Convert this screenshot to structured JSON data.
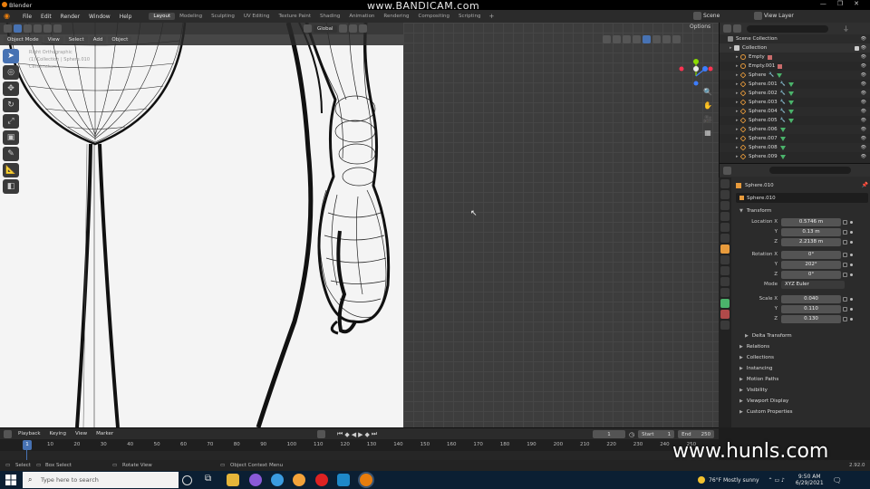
{
  "window": {
    "title": "Blender",
    "recorder_watermark": "www.BANDICAM.com"
  },
  "menubar": {
    "menus": [
      "File",
      "Edit",
      "Render",
      "Window",
      "Help"
    ],
    "workspaces": [
      "Layout",
      "Modeling",
      "Sculpting",
      "UV Editing",
      "Texture Paint",
      "Shading",
      "Animation",
      "Rendering",
      "Compositing",
      "Scripting"
    ],
    "active_workspace": "Layout",
    "scene_label": "Scene",
    "view_layer_label": "View Layer"
  },
  "viewport": {
    "mode": "Object Mode",
    "menus": [
      "View",
      "Select",
      "Add",
      "Object"
    ],
    "transform_orientation": "Global",
    "options_label": "Options",
    "info_lines": [
      "Right Orthographic",
      "(1) Collection | Sphere.010",
      "Centimeters"
    ]
  },
  "outliner": {
    "items": [
      {
        "name": "Scene Collection",
        "type": "scene",
        "indent": 0,
        "mods": 0
      },
      {
        "name": "Collection",
        "type": "collection",
        "indent": 1,
        "mods": 0
      },
      {
        "name": "Empty",
        "type": "empty",
        "indent": 2,
        "mods": 1
      },
      {
        "name": "Empty.001",
        "type": "empty",
        "indent": 2,
        "mods": 1
      },
      {
        "name": "Sphere",
        "type": "mesh",
        "indent": 2,
        "mods": 2
      },
      {
        "name": "Sphere.001",
        "type": "mesh",
        "indent": 2,
        "mods": 2
      },
      {
        "name": "Sphere.002",
        "type": "mesh",
        "indent": 2,
        "mods": 2
      },
      {
        "name": "Sphere.003",
        "type": "mesh",
        "indent": 2,
        "mods": 2
      },
      {
        "name": "Sphere.004",
        "type": "mesh",
        "indent": 2,
        "mods": 2
      },
      {
        "name": "Sphere.005",
        "type": "mesh",
        "indent": 2,
        "mods": 2
      },
      {
        "name": "Sphere.006",
        "type": "mesh",
        "indent": 2,
        "mods": 1
      },
      {
        "name": "Sphere.007",
        "type": "mesh",
        "indent": 2,
        "mods": 1
      },
      {
        "name": "Sphere.008",
        "type": "mesh",
        "indent": 2,
        "mods": 1
      },
      {
        "name": "Sphere.009",
        "type": "mesh",
        "indent": 2,
        "mods": 1
      }
    ]
  },
  "properties": {
    "object_name": "Sphere.010",
    "object_field": "Sphere.010",
    "transform_label": "Transform",
    "location_label": "Location X",
    "location": [
      "0.5746 m",
      "0.13 m",
      "2.2138 m"
    ],
    "rotation_label": "Rotation X",
    "rotation": [
      "0°",
      "202°",
      "0°"
    ],
    "mode_label": "Mode",
    "mode_value": "XYZ Euler",
    "scale_label": "Scale X",
    "scale": [
      "0.040",
      "0.110",
      "0.130"
    ],
    "y_label": "Y",
    "z_label": "Z",
    "delta_label": "Delta Transform",
    "panels": [
      "Relations",
      "Collections",
      "Instancing",
      "Motion Paths",
      "Visibility",
      "Viewport Display",
      "Custom Properties"
    ]
  },
  "timeline": {
    "menus": [
      "Playback",
      "Keying",
      "View",
      "Marker"
    ],
    "current_frame": "1",
    "start_label": "Start",
    "start_value": "1",
    "end_label": "End",
    "end_value": "250",
    "playhead_label": "1",
    "ticks": [
      "10",
      "20",
      "30",
      "40",
      "50",
      "60",
      "70",
      "80",
      "90",
      "100",
      "110",
      "120",
      "130",
      "140",
      "150",
      "160",
      "170",
      "180",
      "190",
      "200",
      "210",
      "220",
      "230",
      "240",
      "250"
    ]
  },
  "statusbar": {
    "left": "Select",
    "box": "Box Select",
    "rotate": "Rotate View",
    "context": "Object Context Menu",
    "version": "2.92.0"
  },
  "watermark": "www.hunls.com",
  "taskbar": {
    "search_placeholder": "Type here to search",
    "weather": "76°F  Mostly sunny",
    "time": "9:50 AM",
    "date": "6/29/2021"
  }
}
